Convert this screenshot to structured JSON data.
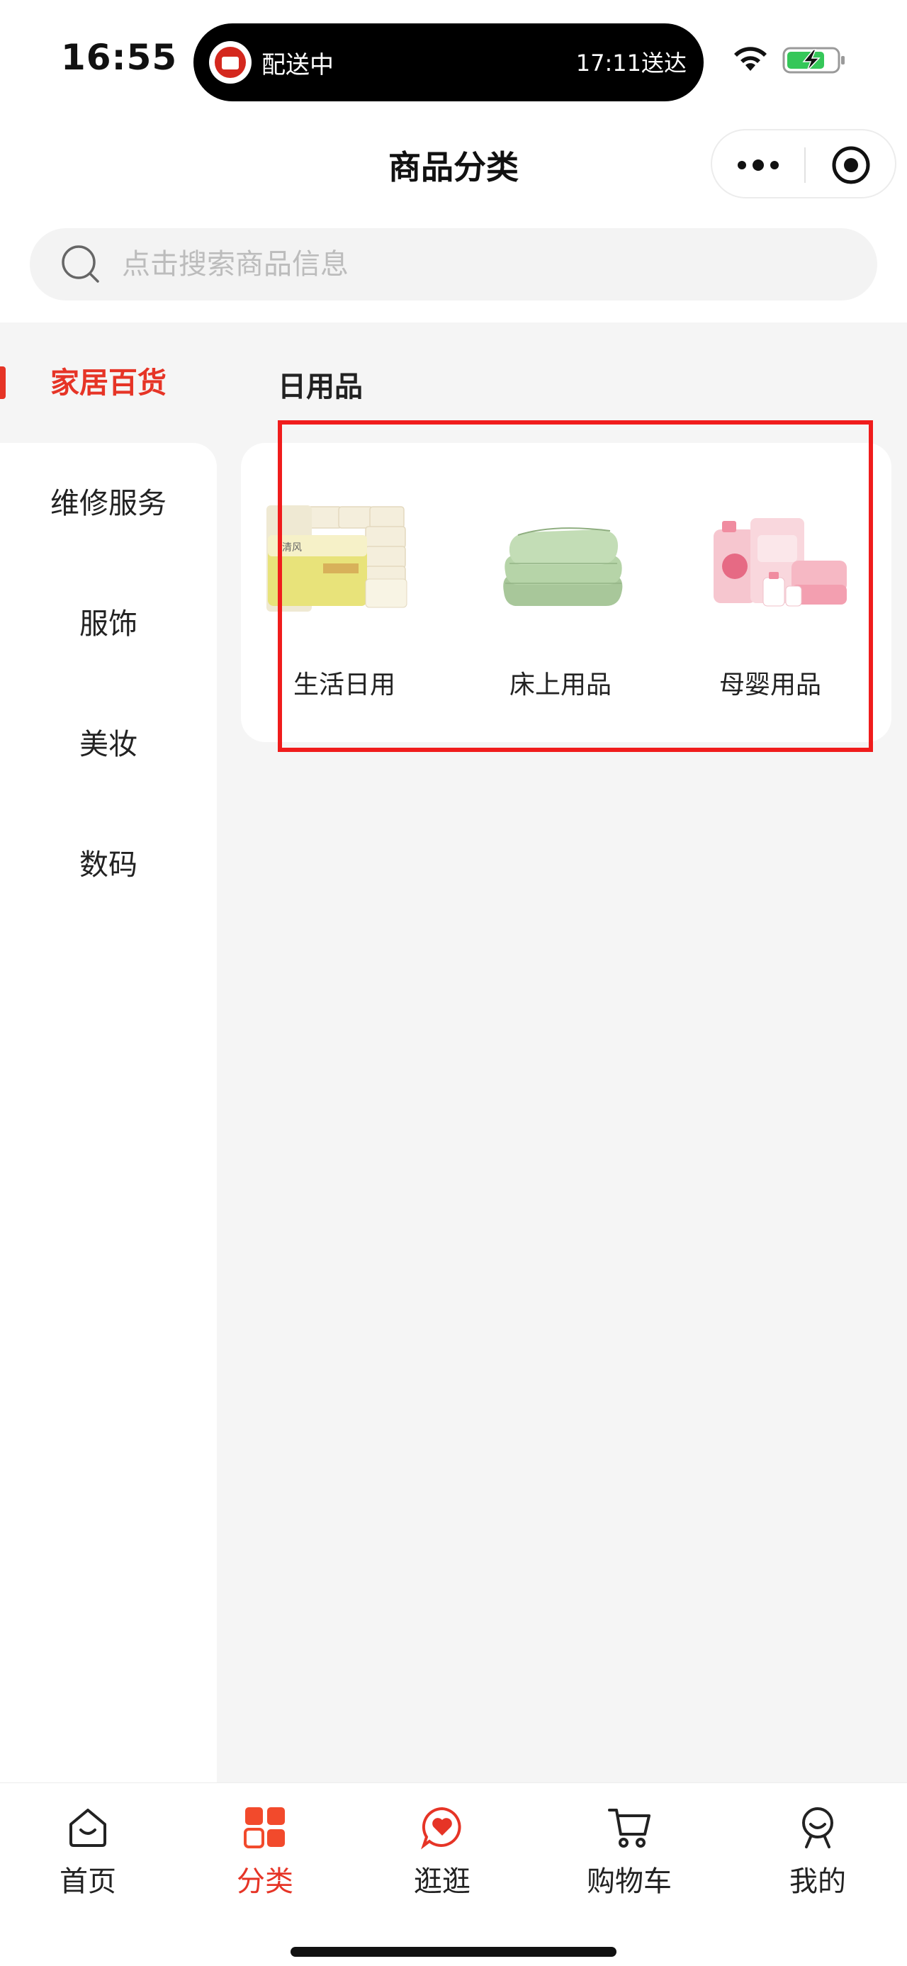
{
  "status_bar": {
    "time": "16:55",
    "live_activity": {
      "status": "配送中",
      "eta": "17:11送达"
    },
    "icons": [
      "wifi-icon",
      "battery-charging-icon"
    ]
  },
  "nav": {
    "title": "商品分类",
    "capsule_icons": [
      "more-icon",
      "close-mini-program-icon"
    ]
  },
  "search": {
    "placeholder": "点击搜索商品信息",
    "icon": "search-icon"
  },
  "sidebar": {
    "items": [
      {
        "label": "家居百货",
        "active": true
      },
      {
        "label": "维修服务",
        "active": false
      },
      {
        "label": "服饰",
        "active": false
      },
      {
        "label": "美妆",
        "active": false
      },
      {
        "label": "数码",
        "active": false
      }
    ]
  },
  "main": {
    "subcategory_title": "日用品",
    "cards": [
      {
        "label": "生活日用",
        "image": "tissue-packs-image"
      },
      {
        "label": "床上用品",
        "image": "folded-blanket-image"
      },
      {
        "label": "母婴用品",
        "image": "baby-care-products-image"
      }
    ]
  },
  "tab_bar": {
    "tabs": [
      {
        "label": "首页",
        "icon": "home-icon",
        "active": false
      },
      {
        "label": "分类",
        "icon": "category-grid-icon",
        "active": true
      },
      {
        "label": "逛逛",
        "icon": "heart-bubble-icon",
        "active": false
      },
      {
        "label": "购物车",
        "icon": "cart-icon",
        "active": false
      },
      {
        "label": "我的",
        "icon": "profile-icon",
        "active": false
      }
    ]
  },
  "colors": {
    "accent": "#e63426",
    "highlight_box": "#f01c1c",
    "page_bg": "#f5f5f5"
  }
}
